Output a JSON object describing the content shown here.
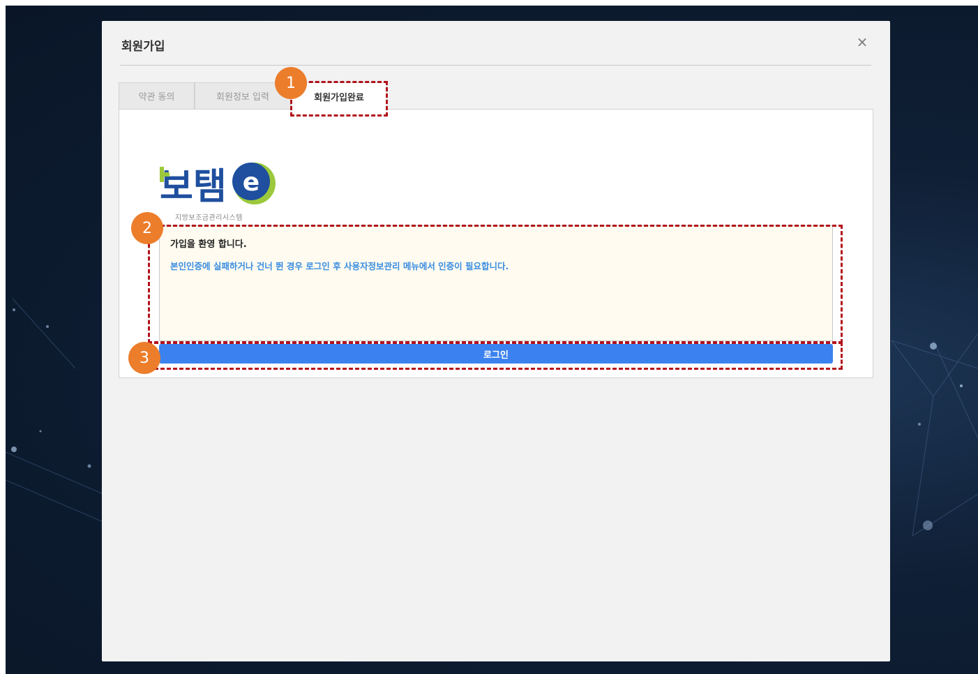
{
  "modal": {
    "title": "회원가입",
    "close_symbol": "×"
  },
  "tabs": [
    {
      "label": "약관 동의",
      "active": false
    },
    {
      "label": "회원정보 입력",
      "active": false
    },
    {
      "label": "회원가입완료",
      "active": true
    }
  ],
  "logo": {
    "brand_text": "보탬",
    "brand_suffix": "e",
    "subtitle": "지방보조금관리시스템"
  },
  "welcome": {
    "title": "가입을 환영 합니다.",
    "description": "본인인증에 실패하거나 건너 뛴 경우 로그인 후 사용자정보관리 메뉴에서 인증이 필요합니다."
  },
  "login_button": {
    "label": "로그인"
  },
  "callouts": [
    {
      "number": "1"
    },
    {
      "number": "2"
    },
    {
      "number": "3"
    }
  ],
  "colors": {
    "accent_blue": "#3b82f0",
    "callout_red": "#b3121c",
    "badge_orange": "#ec7d2b",
    "welcome_bg": "#fffbf0",
    "desc_blue": "#3a8de0"
  }
}
